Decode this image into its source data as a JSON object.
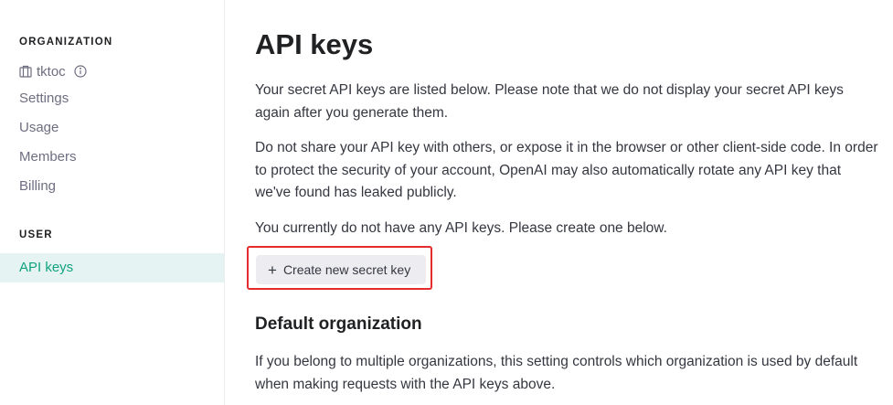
{
  "sidebar": {
    "organization_heading": "ORGANIZATION",
    "org_name": "tktoc",
    "org_icon": "building-icon",
    "info_icon": "info-icon",
    "org_items": [
      {
        "label": "Settings"
      },
      {
        "label": "Usage"
      },
      {
        "label": "Members"
      },
      {
        "label": "Billing"
      }
    ],
    "user_heading": "USER",
    "user_items": [
      {
        "label": "API keys",
        "active": true
      }
    ],
    "active_color": "#10a37f",
    "active_bg": "#e6f3f3"
  },
  "main": {
    "title": "API keys",
    "paragraph_1": "Your secret API keys are listed below. Please note that we do not display your secret API keys again after you generate them.",
    "paragraph_2": "Do not share your API key with others, or expose it in the browser or other client-side code. In order to protect the security of your account, OpenAI may also automatically rotate any API key that we've found has leaked publicly.",
    "paragraph_3": "You currently do not have any API keys. Please create one below.",
    "create_button": {
      "icon": "plus-icon",
      "icon_glyph": "+",
      "label": "Create new secret key"
    },
    "default_org_heading": "Default organization",
    "paragraph_4": "If you belong to multiple organizations, this setting controls which organization is used by default when making requests with the API keys above."
  },
  "colors": {
    "highlight": "#e52b2b",
    "button_bg": "#ececf1"
  }
}
